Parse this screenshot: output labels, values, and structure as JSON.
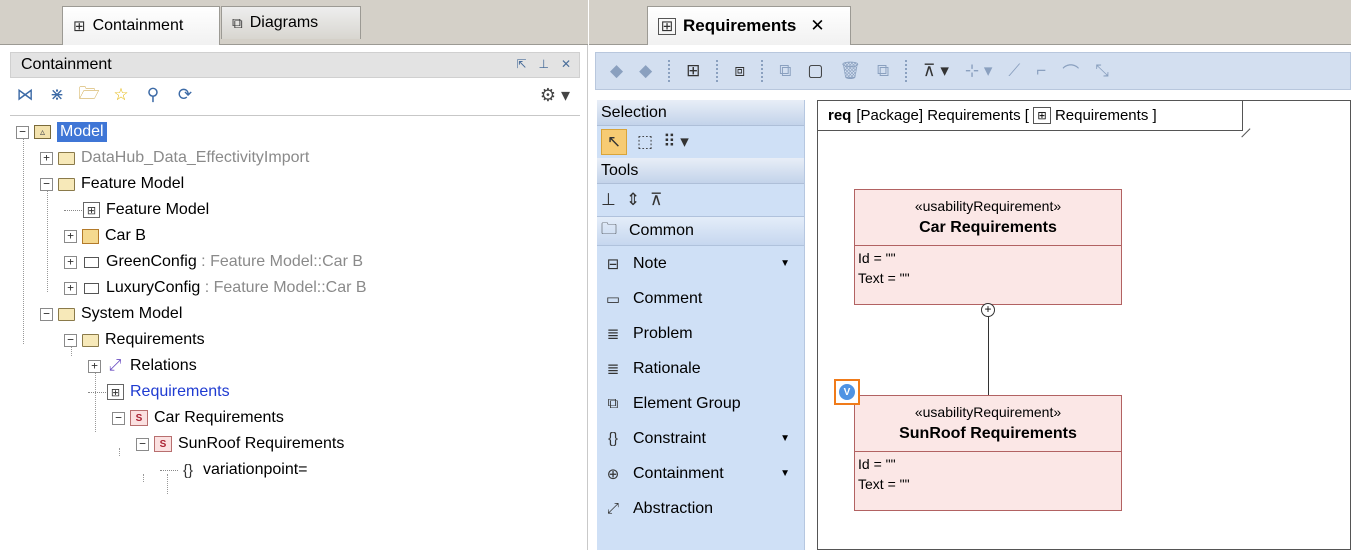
{
  "left_panel": {
    "tabs": [
      {
        "label": "Containment",
        "icon": "containment-tree-icon"
      },
      {
        "label": "Diagrams",
        "icon": "diagrams-icon"
      }
    ],
    "title": "Containment",
    "tree": {
      "model": "Model",
      "datahub": "DataHub_Data_EffectivityImport",
      "feature_model_pkg": "Feature Model",
      "feature_model_diagram": "Feature Model",
      "car_b": "Car B",
      "green_config": "GreenConfig",
      "green_config_type": ": Feature Model::Car B",
      "luxury_config": "LuxuryConfig",
      "luxury_config_type": ": Feature Model::Car B",
      "system_model": "System Model",
      "requirements_pkg": "Requirements",
      "relations": "Relations",
      "requirements_diagram": "Requirements",
      "car_requirements": "Car Requirements",
      "sunroof_requirements": "SunRoof Requirements",
      "variationpoint": "variationpoint="
    }
  },
  "right_panel": {
    "tab_label": "Requirements",
    "palette": {
      "selection_header": "Selection",
      "tools_header": "Tools",
      "group": "Common",
      "items": [
        "Note",
        "Comment",
        "Problem",
        "Rationale",
        "Element Group",
        "Constraint",
        "Containment",
        "Abstraction"
      ]
    },
    "diagram": {
      "frame_keyword": "req",
      "frame_label_pre": "[Package] Requirements [",
      "frame_label_name": "Requirements",
      "frame_label_post": "]",
      "car_box": {
        "stereotype": "«usabilityRequirement»",
        "name": "Car Requirements",
        "id": "Id = \"\"",
        "text": "Text = \"\""
      },
      "sun_box": {
        "stereotype": "«usabilityRequirement»",
        "name": "SunRoof Requirements",
        "id": "Id = \"\"",
        "text": "Text = \"\""
      },
      "marker_color": "#f07b1a"
    }
  }
}
